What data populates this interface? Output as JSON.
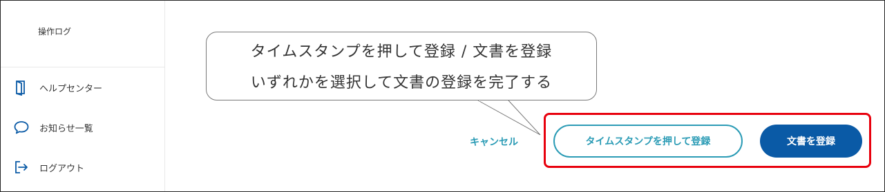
{
  "sidebar": {
    "top_item": "操作ログ",
    "items": [
      {
        "label": "ヘルプセンター",
        "icon": "book-icon"
      },
      {
        "label": "お知らせ一覧",
        "icon": "chat-bubble-icon"
      },
      {
        "label": "ログアウト",
        "icon": "logout-icon"
      }
    ]
  },
  "callout": {
    "line1": "タイムスタンプを押して登録 / 文書を登録",
    "line2": "いずれかを選択して文書の登録を完了する"
  },
  "actions": {
    "cancel_label": "キャンセル",
    "timestamp_register_label": "タイムスタンプを押して登録",
    "register_label": "文書を登録"
  },
  "colors": {
    "accent": "#2a9bb5",
    "primary": "#0a5aa6",
    "highlight": "#e8000d"
  }
}
